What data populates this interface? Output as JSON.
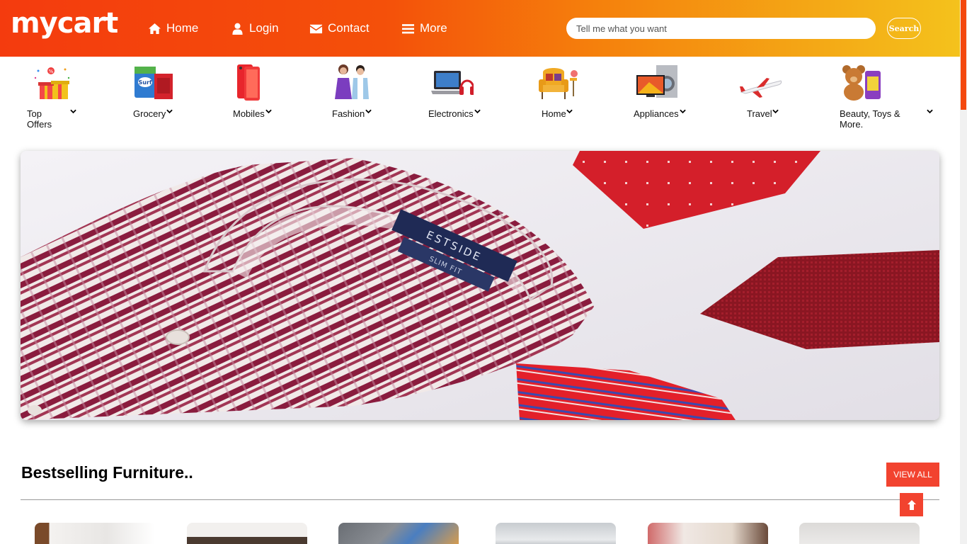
{
  "header": {
    "logo": "mycart",
    "nav": [
      {
        "label": "Home",
        "icon": "home-icon"
      },
      {
        "label": "Login",
        "icon": "user-icon"
      },
      {
        "label": "Contact",
        "icon": "envelope-icon"
      },
      {
        "label": "More",
        "icon": "bars-icon"
      }
    ],
    "search_placeholder": "Tell me what you want",
    "search_button": "Search"
  },
  "categories": [
    {
      "line1": "Top",
      "line2": "Offers",
      "icon": "gift-offers-icon"
    },
    {
      "line1": "Grocery",
      "line2": "",
      "icon": "grocery-icon"
    },
    {
      "line1": "Mobiles",
      "line2": "",
      "icon": "mobile-phone-icon"
    },
    {
      "line1": "Fashion",
      "line2": "",
      "icon": "fashion-icon"
    },
    {
      "line1": "Electronics",
      "line2": "",
      "icon": "laptop-headphones-icon"
    },
    {
      "line1": "Home",
      "line2": "",
      "icon": "armchair-icon"
    },
    {
      "line1": "Appliances",
      "line2": "",
      "icon": "appliances-icon"
    },
    {
      "line1": "Travel",
      "line2": "",
      "icon": "airplane-icon"
    },
    {
      "line1": "Beauty, Toys &",
      "line2": "More.",
      "icon": "teddy-bear-icon"
    }
  ],
  "banner": {
    "alt": "shirt-and-ties-banner"
  },
  "section": {
    "title": "Bestselling Furniture..",
    "view_all": "VIEW ALL"
  },
  "colors": {
    "header_start": "#f43b0e",
    "header_end": "#f4c21c",
    "accent": "#f2432f"
  }
}
